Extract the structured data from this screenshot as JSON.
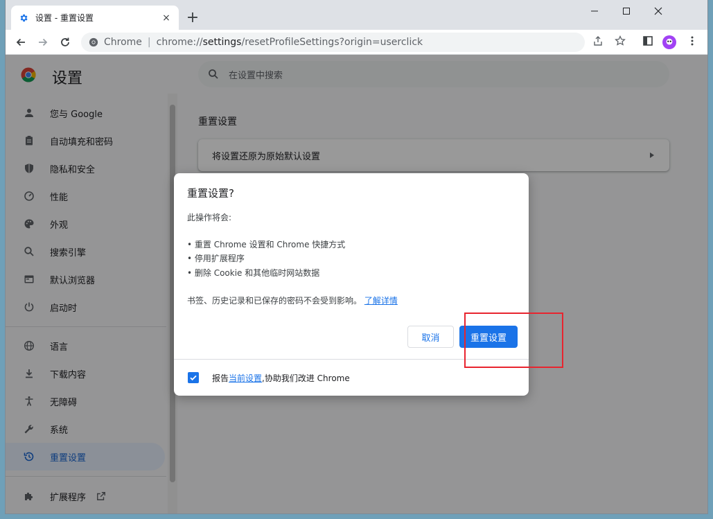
{
  "tab": {
    "title": "设置 - 重置设置",
    "close": "×",
    "new_tab": "+"
  },
  "window_controls": {
    "minimize": "–",
    "maximize": "☐",
    "close": "✕"
  },
  "omnibox": {
    "chip": "Chrome",
    "separator": "|",
    "url_prefix": "chrome://",
    "url_host": "settings",
    "url_path": "/resetProfileSettings?origin=userclick"
  },
  "header": {
    "title": "设置",
    "search_placeholder": "在设置中搜索"
  },
  "sidebar": {
    "items": [
      {
        "label": "您与 Google",
        "icon": "person-icon"
      },
      {
        "label": "自动填充和密码",
        "icon": "clipboard-icon"
      },
      {
        "label": "隐私和安全",
        "icon": "shield-icon"
      },
      {
        "label": "性能",
        "icon": "gauge-icon"
      },
      {
        "label": "外观",
        "icon": "palette-icon"
      },
      {
        "label": "搜索引擎",
        "icon": "search-icon"
      },
      {
        "label": "默认浏览器",
        "icon": "browser-icon"
      },
      {
        "label": "启动时",
        "icon": "power-icon"
      },
      {
        "label": "语言",
        "icon": "globe-icon"
      },
      {
        "label": "下载内容",
        "icon": "download-icon"
      },
      {
        "label": "无障碍",
        "icon": "accessibility-icon"
      },
      {
        "label": "系统",
        "icon": "wrench-icon"
      },
      {
        "label": "重置设置",
        "icon": "history-icon"
      },
      {
        "label": "扩展程序",
        "icon": "puzzle-icon"
      }
    ]
  },
  "content": {
    "section_title": "重置设置",
    "card_label": "将设置还原为原始默认设置"
  },
  "dialog": {
    "title": "重置设置?",
    "intro": "此操作将会:",
    "bullets": [
      "• 重置 Chrome 设置和 Chrome 快捷方式",
      "• 停用扩展程序",
      "• 删除 Cookie 和其他临时网站数据"
    ],
    "note": "书签、历史记录和已保存的密码不会受到影响。",
    "learn_more": "了解详情",
    "cancel_label": "取消",
    "reset_label": "重置设置",
    "footer_prefix": "报告",
    "footer_link": "当前设置",
    "footer_suffix": ",协助我们改进 Chrome",
    "report_checked": true
  },
  "colors": {
    "accent": "#1a73e8",
    "highlight": "#e8242e"
  }
}
